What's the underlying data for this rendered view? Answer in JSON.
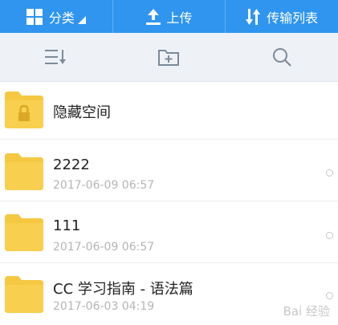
{
  "topbar": {
    "category_label": "分类",
    "upload_label": "上传",
    "transfer_label": "传输列表"
  },
  "toolbar": {
    "sort_icon": "sort-list-icon",
    "new_folder_icon": "new-folder-icon",
    "search_icon": "search-icon"
  },
  "colors": {
    "topbar": "#2f95ee",
    "toolbar": "#eef2f6",
    "folder": "#f5c842",
    "date": "#b5b5b5"
  },
  "files": [
    {
      "name": "隐藏空间",
      "date": "",
      "locked": true
    },
    {
      "name": "2222",
      "date": "2017-06-09  06:57"
    },
    {
      "name": "111",
      "date": "2017-06-09  06:57"
    },
    {
      "name": "CC  学习指南 - 语法篇",
      "date": "2017-06-03  04:19"
    }
  ],
  "watermark": {
    "text": "Bai  经验"
  }
}
